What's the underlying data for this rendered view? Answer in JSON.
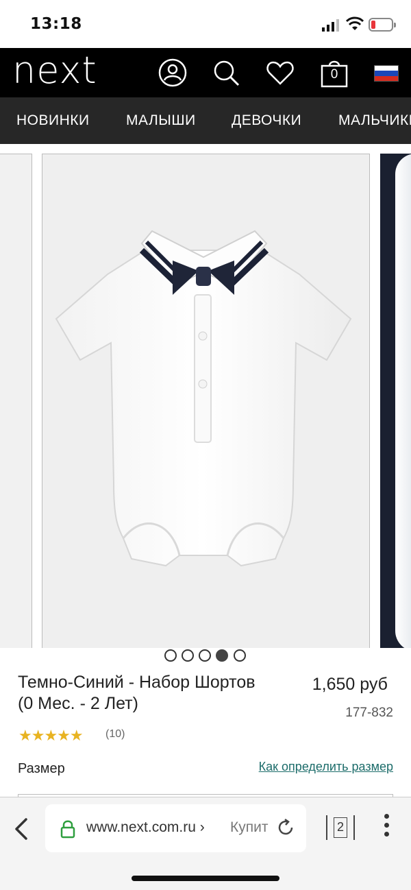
{
  "status": {
    "time": "13:18"
  },
  "header": {
    "logo": "next",
    "bag_count": "0",
    "icons": [
      "account-icon",
      "search-icon",
      "heart-icon",
      "bag-icon",
      "russia-flag-icon"
    ]
  },
  "nav": {
    "items": [
      "НОВИНКИ",
      "МАЛЫШИ",
      "ДЕВОЧКИ",
      "МАЛЬЧИКИ"
    ]
  },
  "gallery": {
    "slide_count": 5,
    "active_index": 4
  },
  "product": {
    "title": "Темно-Синий - Набор Шортов (0 Мес. - 2 Лет)",
    "price": "1,650 руб",
    "sku": "177-832",
    "rating": 5,
    "stars": "★★★★★",
    "reviews": "(10)",
    "size_label": "Размер",
    "size_guide": "Как определить размер"
  },
  "browser": {
    "url": "www.next.com.ru ›",
    "page_title": "Купит",
    "tab_count": "2"
  },
  "colors": {
    "header_bg": "#000000",
    "nav_bg": "#272727",
    "link": "#1c6c6a",
    "star": "#e8b321"
  }
}
